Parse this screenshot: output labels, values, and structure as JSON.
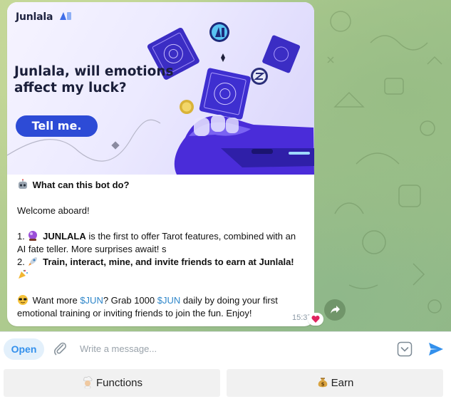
{
  "message": {
    "banner": {
      "brand": "Junlala",
      "headline": [
        "Junlala, will emotions",
        "affect my luck?"
      ],
      "cta": "Tell me."
    },
    "heading": "What can this bot do?",
    "welcome": "Welcome aboard!",
    "item1_prefix": "1.",
    "item1_bold": "JUNLALA",
    "item1_text": " is the first to offer Tarot features, combined with an",
    "item1_line2": "AI fate teller. More surprises await! s",
    "item2_prefix": "2.",
    "item2_bold": "Train, interact, mine, and invite friends to earn at Junlala!",
    "para_a": "Want more ",
    "cashtag1": "$JUN",
    "para_b": "? Grab 1000 ",
    "cashtag2": "$JUN",
    "para_c": " daily by doing your first",
    "para_line2": "emotional training or inviting friends to join the fun. Enjoy!",
    "time": "15:37",
    "reaction_icon": "heart-icon"
  },
  "composer": {
    "open_label": "Open",
    "placeholder": "Write a message..."
  },
  "keyboard": {
    "buttons": [
      {
        "label": "Functions",
        "icon": "chef-icon"
      },
      {
        "label": "Earn",
        "icon": "money-bag-icon"
      }
    ]
  },
  "colors": {
    "accent": "#3390ec",
    "cta": "#2d4bd6",
    "cashtag": "#2e86c9",
    "reaction": "#e0245e"
  }
}
